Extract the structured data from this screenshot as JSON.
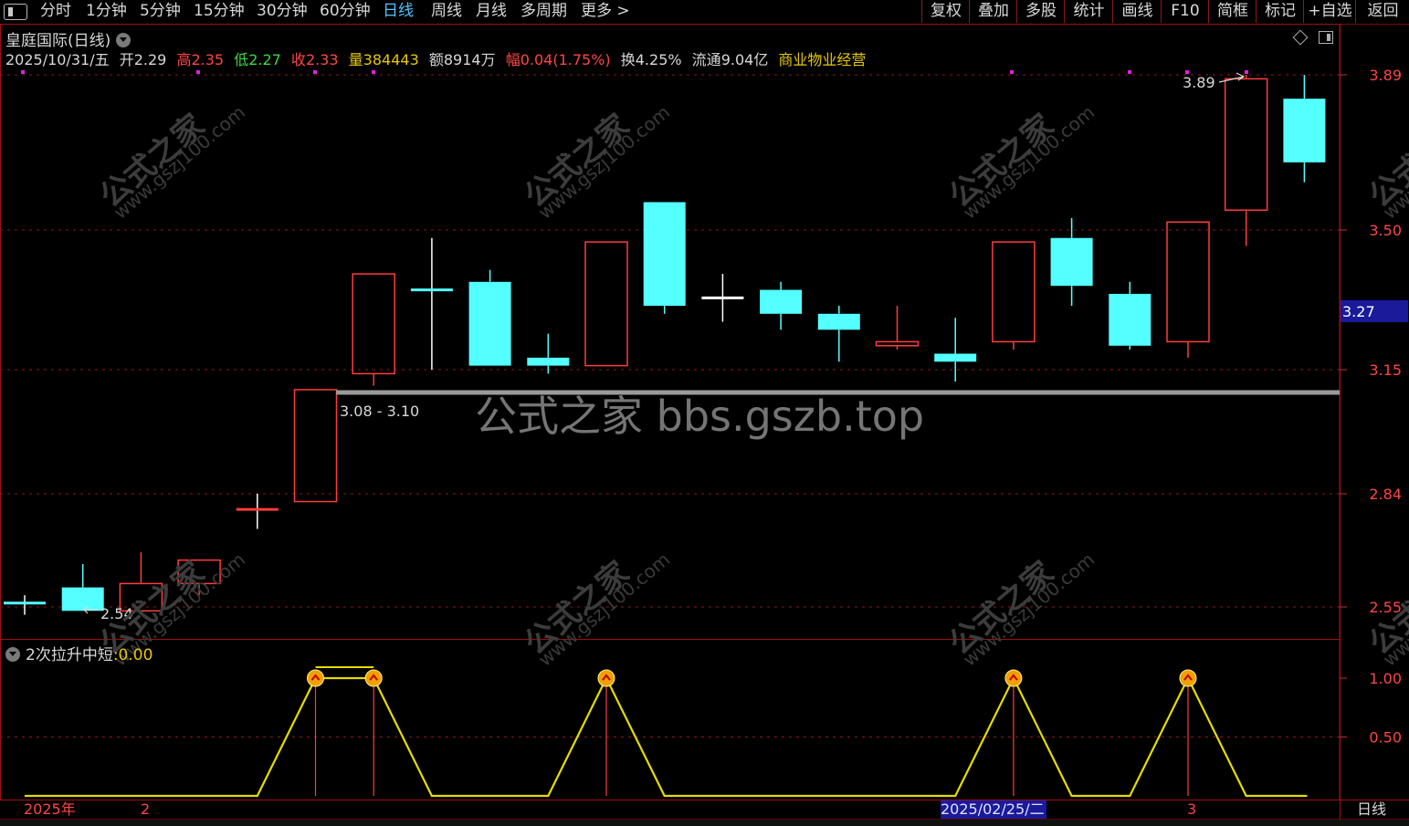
{
  "toolbar": {
    "left_tabs": [
      "分时",
      "1分钟",
      "5分钟",
      "15分钟",
      "30分钟",
      "60分钟",
      "日线",
      "周线",
      "月线",
      "多周期",
      "更多 >"
    ],
    "active_tab": "日线",
    "right_buttons": [
      "复权",
      "叠加",
      "多股",
      "统计",
      "画线",
      "F10",
      "简框",
      "标记",
      "+自选",
      "返回"
    ]
  },
  "header": {
    "stock_name": "皇庭国际(日线)",
    "date": "2025/10/31/五",
    "open_label": "开",
    "open": "2.29",
    "high_label": "高",
    "high": "2.35",
    "low_label": "低",
    "low": "2.27",
    "close_label": "收",
    "close": "2.33",
    "volume_label": "量",
    "volume": "384443",
    "amount_label": "额",
    "amount": "8914万",
    "change_label": "幅",
    "change": "0.04(1.75%)",
    "turnover_label": "换",
    "turnover": "4.25%",
    "float_label": "流通",
    "float": "9.04亿",
    "sector": "商业物业经营"
  },
  "subchart": {
    "name": "2次拉升中短",
    "value": ":0.00"
  },
  "date_bar": {
    "year": "2025年",
    "m1": "2",
    "cursor_date": "2025/02/25/二",
    "m2": "3",
    "period": "日线"
  },
  "watermark": {
    "center": "公式之家 bbs.gszb.top",
    "cn": "公式之家",
    "url": "www.gszj100.com"
  },
  "colors": {
    "up": "#ff3c3c",
    "down": "#54ffff",
    "indicator": "#e6dc00",
    "grid": "#8b1a1a",
    "price_box": "#1a1a9a"
  },
  "chart_data": {
    "type": "candlestick",
    "price_axis": {
      "ticks": [
        3.89,
        3.5,
        3.15,
        2.84,
        2.55
      ],
      "tick_labels": [
        "3.89",
        "3.50",
        "3.15",
        "2.84",
        "2.55"
      ],
      "current_price": "3.27"
    },
    "candles": [
      {
        "o": 2.56,
        "c": 2.56,
        "h": 2.58,
        "l": 2.53
      },
      {
        "o": 2.6,
        "c": 2.54,
        "h": 2.66,
        "l": 2.54
      },
      {
        "o": 2.54,
        "c": 2.61,
        "h": 2.69,
        "l": 2.53
      },
      {
        "o": 2.61,
        "c": 2.67,
        "h": 2.67,
        "l": 2.58
      },
      {
        "o": 2.8,
        "c": 2.8,
        "h": 2.84,
        "l": 2.75
      },
      {
        "o": 2.82,
        "c": 3.1,
        "h": 3.1,
        "l": 2.82
      },
      {
        "o": 3.14,
        "c": 3.39,
        "h": 3.39,
        "l": 3.11
      },
      {
        "o": 3.35,
        "c": 3.35,
        "h": 3.48,
        "l": 3.15
      },
      {
        "o": 3.37,
        "c": 3.16,
        "h": 3.4,
        "l": 3.16
      },
      {
        "o": 3.18,
        "c": 3.16,
        "h": 3.24,
        "l": 3.14
      },
      {
        "o": 3.16,
        "c": 3.47,
        "h": 3.47,
        "l": 3.16
      },
      {
        "o": 3.57,
        "c": 3.31,
        "h": 3.57,
        "l": 3.29
      },
      {
        "o": 3.33,
        "c": 3.33,
        "h": 3.39,
        "l": 3.27
      },
      {
        "o": 3.35,
        "c": 3.29,
        "h": 3.37,
        "l": 3.25
      },
      {
        "o": 3.29,
        "c": 3.25,
        "h": 3.31,
        "l": 3.17
      },
      {
        "o": 3.21,
        "c": 3.22,
        "h": 3.31,
        "l": 3.2
      },
      {
        "o": 3.19,
        "c": 3.17,
        "h": 3.28,
        "l": 3.12
      },
      {
        "o": 3.22,
        "c": 3.47,
        "h": 3.47,
        "l": 3.2
      },
      {
        "o": 3.48,
        "c": 3.36,
        "h": 3.53,
        "l": 3.31
      },
      {
        "o": 3.34,
        "c": 3.21,
        "h": 3.37,
        "l": 3.2
      },
      {
        "o": 3.22,
        "c": 3.52,
        "h": 3.52,
        "l": 3.18
      },
      {
        "o": 3.55,
        "c": 3.88,
        "h": 3.89,
        "l": 3.46
      },
      {
        "o": 3.83,
        "c": 3.67,
        "h": 3.89,
        "l": 3.62
      }
    ],
    "annotations": {
      "high_label": "3.89",
      "low_label": "2.54",
      "range_label": "3.08 - 3.10",
      "support_level": 3.09
    },
    "indicator": {
      "name": "2次拉升中短",
      "ticks": [
        1.0,
        0.5
      ],
      "tick_labels": [
        "1.00",
        "0.50"
      ],
      "values": [
        0,
        0,
        0,
        0,
        0,
        1,
        1,
        0,
        0,
        0,
        1,
        0,
        0,
        0,
        0,
        0,
        0,
        1,
        0,
        0,
        1,
        0,
        0
      ],
      "signal_indices": [
        5,
        6,
        10,
        17,
        20
      ]
    }
  }
}
